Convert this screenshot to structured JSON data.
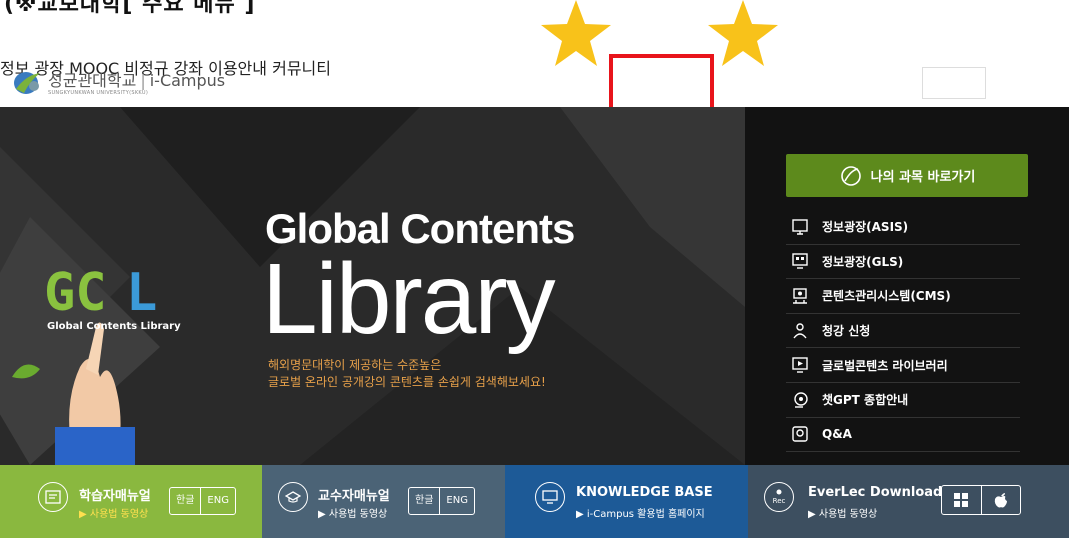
{
  "top_cut_text": "(※교보대학[ 주요 메뉴 ]",
  "header": {
    "logo_main": "성균관대학교",
    "logo_brand": "i-Campus",
    "logo_sub": "SUNGKYUNKWAN UNIVERSITY(SKKU)",
    "nav": [
      "정보 광장",
      "MOOC",
      "비정규 강좌",
      "이용안내",
      "커뮤니티"
    ]
  },
  "hero": {
    "title1": "Global Contents",
    "title2": "Library",
    "gcl_logo": "GCL",
    "gcl_caption": "Global Contents Library",
    "subtitle1": "해외명문대학이 제공하는 수준높은",
    "subtitle2": "글로벌 온라인 공개강의 콘텐츠를 손쉽게 검색해보세요!",
    "my_course": "나의 과목 바로가기",
    "menu": [
      {
        "label": "정보광장(ASIS)",
        "icon": "monitor-icon"
      },
      {
        "label": "정보광장(GLS)",
        "icon": "grid-monitor-icon"
      },
      {
        "label": "콘텐츠관리시스템(CMS)",
        "icon": "cms-icon"
      },
      {
        "label": "청강 신청",
        "icon": "people-icon"
      },
      {
        "label": "글로벌콘텐츠 라이브러리",
        "icon": "play-monitor-icon"
      },
      {
        "label": "챗GPT 종합안내",
        "icon": "ai-head-icon"
      },
      {
        "label": "Q&A",
        "icon": "qa-icon"
      }
    ]
  },
  "bottom": {
    "student": {
      "title": "학습자매뉴얼",
      "sub": "▶ 사용법 동영상",
      "kor": "한글",
      "eng": "ENG"
    },
    "professor": {
      "title": "교수자매뉴얼",
      "sub": "▶ 사용법 동영상",
      "kor": "한글",
      "eng": "ENG"
    },
    "kb": {
      "title": "KNOWLEDGE BASE",
      "sub": "▶ i-Campus 활용법 홈페이지"
    },
    "everlec": {
      "title": "EverLec Download",
      "sub": "▶ 사용법 동영상",
      "rec": "Rec"
    }
  },
  "colors": {
    "green": "#8ab83f",
    "green_dark": "#5d8a1c",
    "highlight": "#e8141b",
    "star": "#f8c21a",
    "orange": "#e8a14a"
  }
}
